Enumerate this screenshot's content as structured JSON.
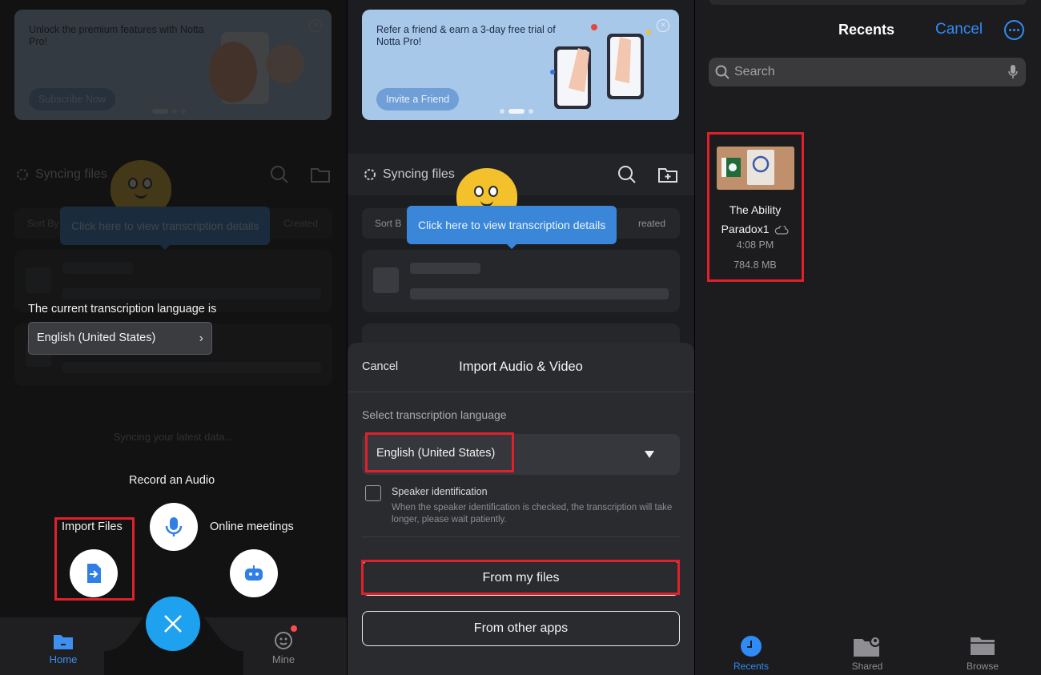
{
  "panel1": {
    "banner": {
      "text": "Unlock the premium features with Notta Pro!",
      "button": "Subscribe Now",
      "close": "×"
    },
    "sync": {
      "label": "Syncing files"
    },
    "sort": {
      "left": "Sort By",
      "right": "Created"
    },
    "tooltip": "Click here to view transcription details",
    "syncing_msg": "Syncing your latest data...",
    "language_note": "The current transcription language is",
    "language_value": "English (United States)",
    "language_chevron": "›",
    "fab": {
      "record_label": "Record an Audio",
      "import_label": "Import Files",
      "meetings_label": "Online meetings"
    },
    "tabs": {
      "home": "Home",
      "mine": "Mine"
    },
    "colors": {
      "accent": "#1ea2f0",
      "highlight": "#e0202a"
    }
  },
  "panel2": {
    "banner": {
      "text": "Refer a friend & earn a 3-day free trial of Notta Pro!",
      "button": "Invite a Friend",
      "close": "×"
    },
    "sync": {
      "label": "Syncing files"
    },
    "sort": {
      "left": "Sort B",
      "right": "reated"
    },
    "tooltip": "Click here to view transcription details",
    "sheet": {
      "cancel": "Cancel",
      "title": "Import Audio & Video",
      "select_label": "Select transcription language",
      "select_value": "English (United States)",
      "speaker_title": "Speaker identification",
      "speaker_desc": "When the speaker identification is checked, the transcription will take longer, please wait patiently.",
      "from_my_files": "From my files",
      "from_other_apps": "From other apps"
    }
  },
  "panel3": {
    "title": "Recents",
    "cancel": "Cancel",
    "search_placeholder": "Search",
    "file": {
      "name_line1": "The Ability",
      "name_line2": "Paradox1",
      "time": "4:08 PM",
      "size": "784.8 MB"
    },
    "tabs": {
      "recents": "Recents",
      "shared": "Shared",
      "browse": "Browse"
    },
    "colors": {
      "accent": "#2f8bf5"
    }
  }
}
